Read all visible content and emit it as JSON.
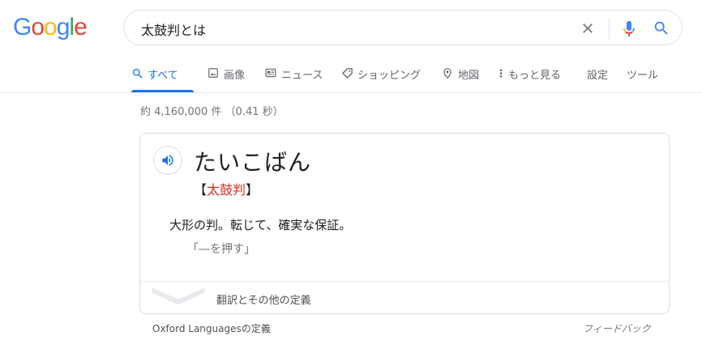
{
  "logo": {
    "letters": [
      "G",
      "o",
      "o",
      "g",
      "l",
      "e"
    ],
    "colors": [
      "#4285F4",
      "#EA4335",
      "#FBBC05",
      "#4285F4",
      "#34A853",
      "#EA4335"
    ]
  },
  "search": {
    "query": "太鼓判とは"
  },
  "tabs": [
    {
      "label": "すべて",
      "icon": "search-icon",
      "active": true
    },
    {
      "label": "画像",
      "icon": "image-icon"
    },
    {
      "label": "ニュース",
      "icon": "news-icon"
    },
    {
      "label": "ショッピング",
      "icon": "tag-icon"
    },
    {
      "label": "地図",
      "icon": "map-pin-icon"
    },
    {
      "label": "もっと見る",
      "icon": "more-vert-icon"
    },
    {
      "label": "設定"
    },
    {
      "label": "ツール"
    }
  ],
  "results": {
    "stats": "約 4,160,000 件 （0.41 秒）"
  },
  "dictionary": {
    "reading": "たいこばん",
    "kanji_open": "【",
    "kanji": "太鼓判",
    "kanji_close": "】",
    "definition": "大形の判。転じて、確実な保証。",
    "example": "「―を押す」",
    "more_label": "翻訳とその他の定義"
  },
  "footer": {
    "source": "Oxford Languagesの定義",
    "feedback": "フィードバック"
  },
  "colors": {
    "accent": "#1a73e8",
    "kanji_red": "#d93025"
  }
}
